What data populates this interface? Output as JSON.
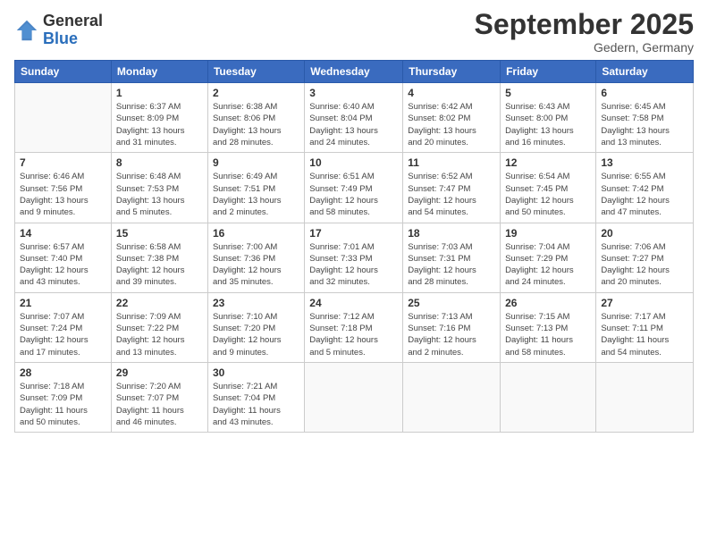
{
  "logo": {
    "general": "General",
    "blue": "Blue"
  },
  "title": "September 2025",
  "location": "Gedern, Germany",
  "days_of_week": [
    "Sunday",
    "Monday",
    "Tuesday",
    "Wednesday",
    "Thursday",
    "Friday",
    "Saturday"
  ],
  "weeks": [
    [
      {
        "day": "",
        "info": ""
      },
      {
        "day": "1",
        "info": "Sunrise: 6:37 AM\nSunset: 8:09 PM\nDaylight: 13 hours\nand 31 minutes."
      },
      {
        "day": "2",
        "info": "Sunrise: 6:38 AM\nSunset: 8:06 PM\nDaylight: 13 hours\nand 28 minutes."
      },
      {
        "day": "3",
        "info": "Sunrise: 6:40 AM\nSunset: 8:04 PM\nDaylight: 13 hours\nand 24 minutes."
      },
      {
        "day": "4",
        "info": "Sunrise: 6:42 AM\nSunset: 8:02 PM\nDaylight: 13 hours\nand 20 minutes."
      },
      {
        "day": "5",
        "info": "Sunrise: 6:43 AM\nSunset: 8:00 PM\nDaylight: 13 hours\nand 16 minutes."
      },
      {
        "day": "6",
        "info": "Sunrise: 6:45 AM\nSunset: 7:58 PM\nDaylight: 13 hours\nand 13 minutes."
      }
    ],
    [
      {
        "day": "7",
        "info": "Sunrise: 6:46 AM\nSunset: 7:56 PM\nDaylight: 13 hours\nand 9 minutes."
      },
      {
        "day": "8",
        "info": "Sunrise: 6:48 AM\nSunset: 7:53 PM\nDaylight: 13 hours\nand 5 minutes."
      },
      {
        "day": "9",
        "info": "Sunrise: 6:49 AM\nSunset: 7:51 PM\nDaylight: 13 hours\nand 2 minutes."
      },
      {
        "day": "10",
        "info": "Sunrise: 6:51 AM\nSunset: 7:49 PM\nDaylight: 12 hours\nand 58 minutes."
      },
      {
        "day": "11",
        "info": "Sunrise: 6:52 AM\nSunset: 7:47 PM\nDaylight: 12 hours\nand 54 minutes."
      },
      {
        "day": "12",
        "info": "Sunrise: 6:54 AM\nSunset: 7:45 PM\nDaylight: 12 hours\nand 50 minutes."
      },
      {
        "day": "13",
        "info": "Sunrise: 6:55 AM\nSunset: 7:42 PM\nDaylight: 12 hours\nand 47 minutes."
      }
    ],
    [
      {
        "day": "14",
        "info": "Sunrise: 6:57 AM\nSunset: 7:40 PM\nDaylight: 12 hours\nand 43 minutes."
      },
      {
        "day": "15",
        "info": "Sunrise: 6:58 AM\nSunset: 7:38 PM\nDaylight: 12 hours\nand 39 minutes."
      },
      {
        "day": "16",
        "info": "Sunrise: 7:00 AM\nSunset: 7:36 PM\nDaylight: 12 hours\nand 35 minutes."
      },
      {
        "day": "17",
        "info": "Sunrise: 7:01 AM\nSunset: 7:33 PM\nDaylight: 12 hours\nand 32 minutes."
      },
      {
        "day": "18",
        "info": "Sunrise: 7:03 AM\nSunset: 7:31 PM\nDaylight: 12 hours\nand 28 minutes."
      },
      {
        "day": "19",
        "info": "Sunrise: 7:04 AM\nSunset: 7:29 PM\nDaylight: 12 hours\nand 24 minutes."
      },
      {
        "day": "20",
        "info": "Sunrise: 7:06 AM\nSunset: 7:27 PM\nDaylight: 12 hours\nand 20 minutes."
      }
    ],
    [
      {
        "day": "21",
        "info": "Sunrise: 7:07 AM\nSunset: 7:24 PM\nDaylight: 12 hours\nand 17 minutes."
      },
      {
        "day": "22",
        "info": "Sunrise: 7:09 AM\nSunset: 7:22 PM\nDaylight: 12 hours\nand 13 minutes."
      },
      {
        "day": "23",
        "info": "Sunrise: 7:10 AM\nSunset: 7:20 PM\nDaylight: 12 hours\nand 9 minutes."
      },
      {
        "day": "24",
        "info": "Sunrise: 7:12 AM\nSunset: 7:18 PM\nDaylight: 12 hours\nand 5 minutes."
      },
      {
        "day": "25",
        "info": "Sunrise: 7:13 AM\nSunset: 7:16 PM\nDaylight: 12 hours\nand 2 minutes."
      },
      {
        "day": "26",
        "info": "Sunrise: 7:15 AM\nSunset: 7:13 PM\nDaylight: 11 hours\nand 58 minutes."
      },
      {
        "day": "27",
        "info": "Sunrise: 7:17 AM\nSunset: 7:11 PM\nDaylight: 11 hours\nand 54 minutes."
      }
    ],
    [
      {
        "day": "28",
        "info": "Sunrise: 7:18 AM\nSunset: 7:09 PM\nDaylight: 11 hours\nand 50 minutes."
      },
      {
        "day": "29",
        "info": "Sunrise: 7:20 AM\nSunset: 7:07 PM\nDaylight: 11 hours\nand 46 minutes."
      },
      {
        "day": "30",
        "info": "Sunrise: 7:21 AM\nSunset: 7:04 PM\nDaylight: 11 hours\nand 43 minutes."
      },
      {
        "day": "",
        "info": ""
      },
      {
        "day": "",
        "info": ""
      },
      {
        "day": "",
        "info": ""
      },
      {
        "day": "",
        "info": ""
      }
    ]
  ]
}
